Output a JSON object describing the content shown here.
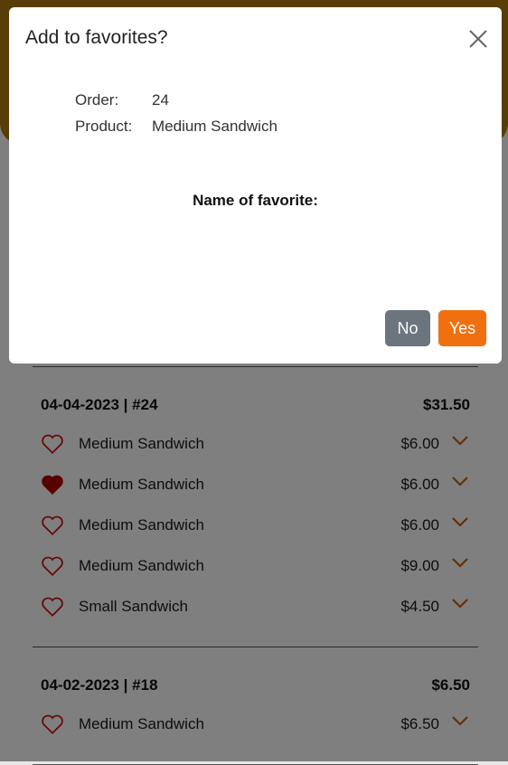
{
  "modal": {
    "title": "Add to favorites?",
    "order_label": "Order:",
    "order_value": "24",
    "product_label": "Product:",
    "product_value": "Medium Sandwich",
    "favorite_name_label": "Name of favorite:",
    "no_label": "No",
    "yes_label": "Yes"
  },
  "orders": [
    {
      "header": "04-04-2023 | #24",
      "total": "$31.50",
      "items": [
        {
          "name": "Medium Sandwich",
          "price": "$6.00",
          "favorited": false
        },
        {
          "name": "Medium Sandwich",
          "price": "$6.00",
          "favorited": true
        },
        {
          "name": "Medium Sandwich",
          "price": "$6.00",
          "favorited": false
        },
        {
          "name": "Medium Sandwich",
          "price": "$9.00",
          "favorited": false
        },
        {
          "name": "Small Sandwich",
          "price": "$4.50",
          "favorited": false
        }
      ]
    },
    {
      "header": "04-02-2023 | #18",
      "total": "$6.50",
      "items": [
        {
          "name": "Medium Sandwich",
          "price": "$6.50",
          "favorited": false
        }
      ]
    }
  ],
  "colors": {
    "header_band": "#b07b10",
    "heart": "#d01010",
    "chevron": "#c06010",
    "yes_button": "#f07010",
    "no_button": "#6c757d"
  },
  "icons": {
    "heart_outline": "heart-outline-icon",
    "heart_filled": "heart-filled-icon",
    "chevron": "chevron-down-icon",
    "close": "close-icon"
  }
}
